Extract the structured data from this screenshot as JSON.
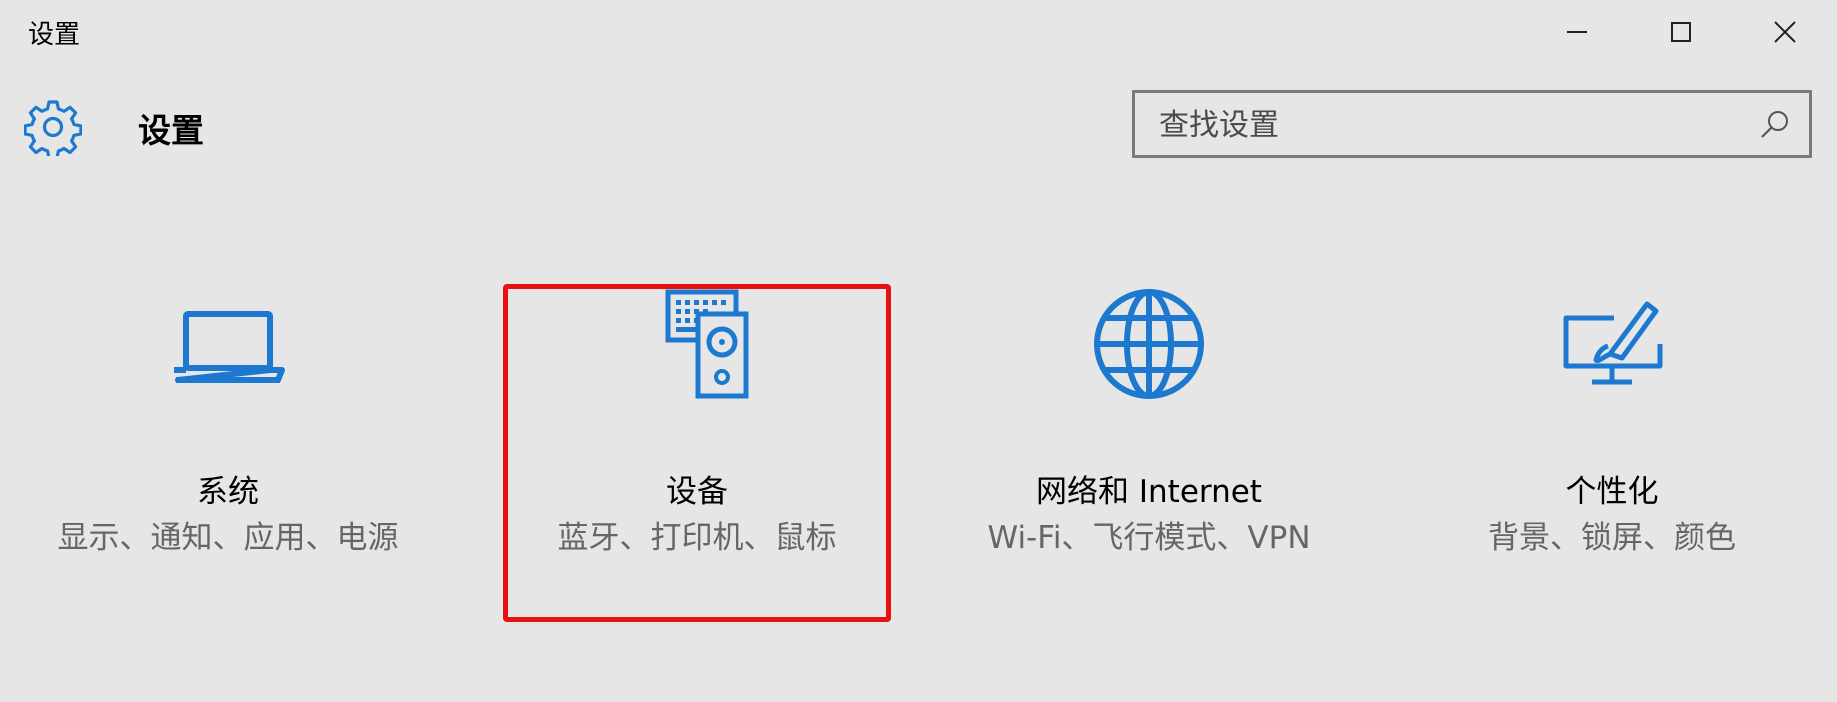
{
  "window": {
    "title": "设置"
  },
  "header": {
    "title": "设置",
    "icon": "gear-icon"
  },
  "search": {
    "placeholder": "查找设置",
    "value": ""
  },
  "tiles": [
    {
      "title": "系统",
      "subtitle": "显示、通知、应用、电源",
      "icon": "laptop-icon"
    },
    {
      "title": "设备",
      "subtitle": "蓝牙、打印机、鼠标",
      "icon": "devices-icon"
    },
    {
      "title": "网络和 Internet",
      "subtitle": "Wi-Fi、飞行模式、VPN",
      "icon": "globe-icon"
    },
    {
      "title": "个性化",
      "subtitle": "背景、锁屏、颜色",
      "icon": "personalization-icon"
    }
  ],
  "colors": {
    "accent": "#1d79d0",
    "background": "#e6e6e6",
    "highlight": "#e81010"
  }
}
